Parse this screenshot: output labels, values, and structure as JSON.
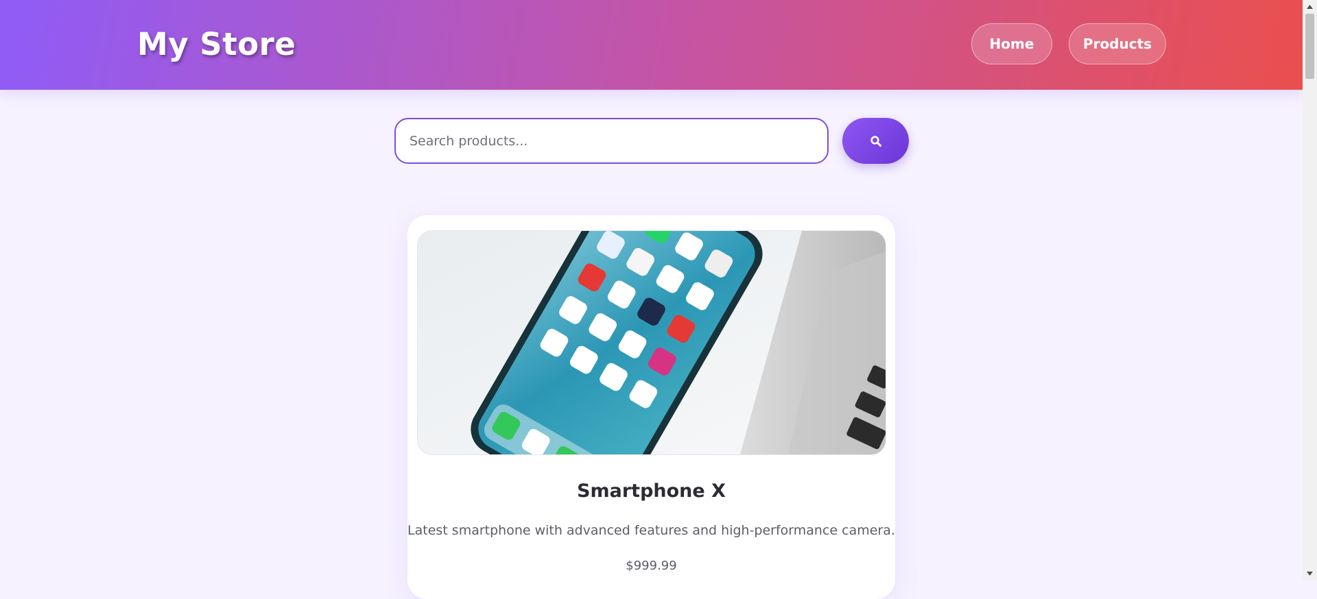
{
  "header": {
    "brand": "My Store",
    "nav": [
      {
        "label": "Home"
      },
      {
        "label": "Products"
      }
    ]
  },
  "search": {
    "placeholder": "Search products...",
    "value": "",
    "button_icon": "search-icon"
  },
  "products": [
    {
      "name": "Smartphone X",
      "description": "Latest smartphone with advanced features and high-performance camera.",
      "price": "$999.99",
      "image": "smartphone-photo"
    }
  ],
  "colors": {
    "header_gradient_start": "#8f5cf7",
    "header_gradient_end": "#ea4f4e",
    "accent": "#7b4ee0",
    "page_background": "#f6f2ff"
  }
}
